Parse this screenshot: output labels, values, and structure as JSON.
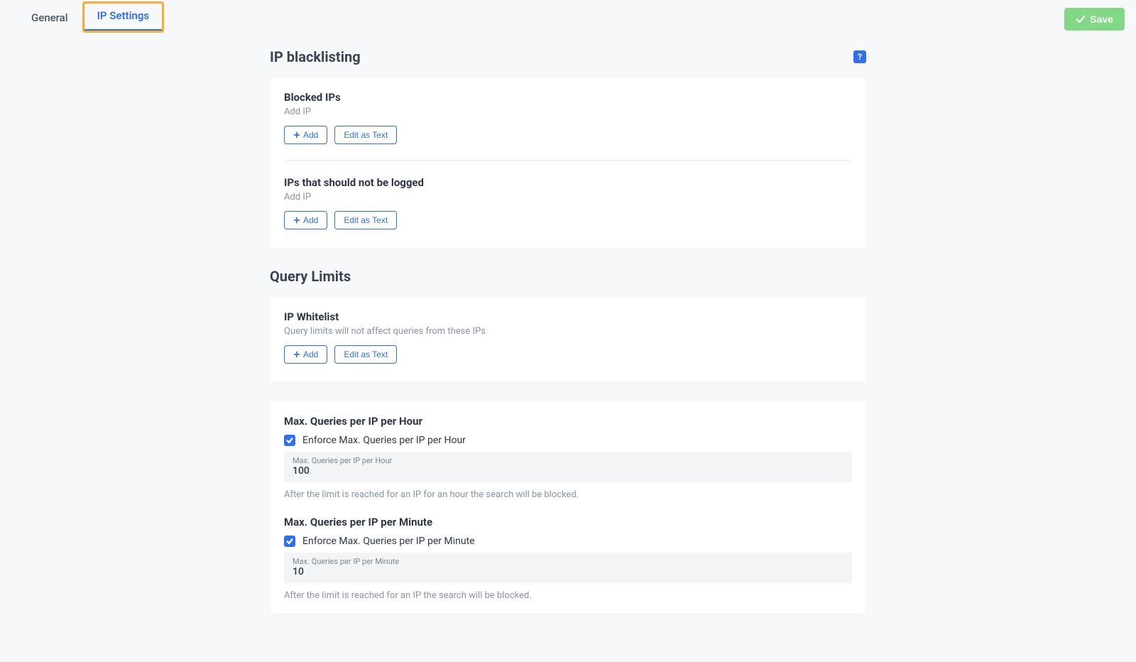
{
  "tabs": {
    "general": "General",
    "ip_settings": "IP Settings"
  },
  "save_button": "Save",
  "sections": {
    "ip_blacklisting": {
      "title": "IP blacklisting",
      "help_symbol": "?",
      "blocked_ips": {
        "title": "Blocked IPs",
        "desc": "Add IP",
        "add_btn": "Add",
        "edit_btn": "Edit as Text"
      },
      "not_logged": {
        "title": "IPs that should not be logged",
        "desc": "Add IP",
        "add_btn": "Add",
        "edit_btn": "Edit as Text"
      }
    },
    "query_limits": {
      "title": "Query Limits",
      "whitelist": {
        "title": "IP Whitelist",
        "desc": "Query limits will not affect queries from these IPs",
        "add_btn": "Add",
        "edit_btn": "Edit as Text"
      },
      "per_hour": {
        "title": "Max. Queries per IP per Hour",
        "check_label": "Enforce Max. Queries per IP per Hour",
        "input_label": "Max. Queries per IP per Hour",
        "value": "100",
        "helper": "After the limit is reached for an IP for an hour the search will be blocked."
      },
      "per_minute": {
        "title": "Max. Queries per IP per Minute",
        "check_label": "Enforce Max. Queries per IP per Minute",
        "input_label": "Max. Queries per IP per Minute",
        "value": "10",
        "helper": "After the limit is reached for an IP the search will be blocked."
      }
    }
  }
}
